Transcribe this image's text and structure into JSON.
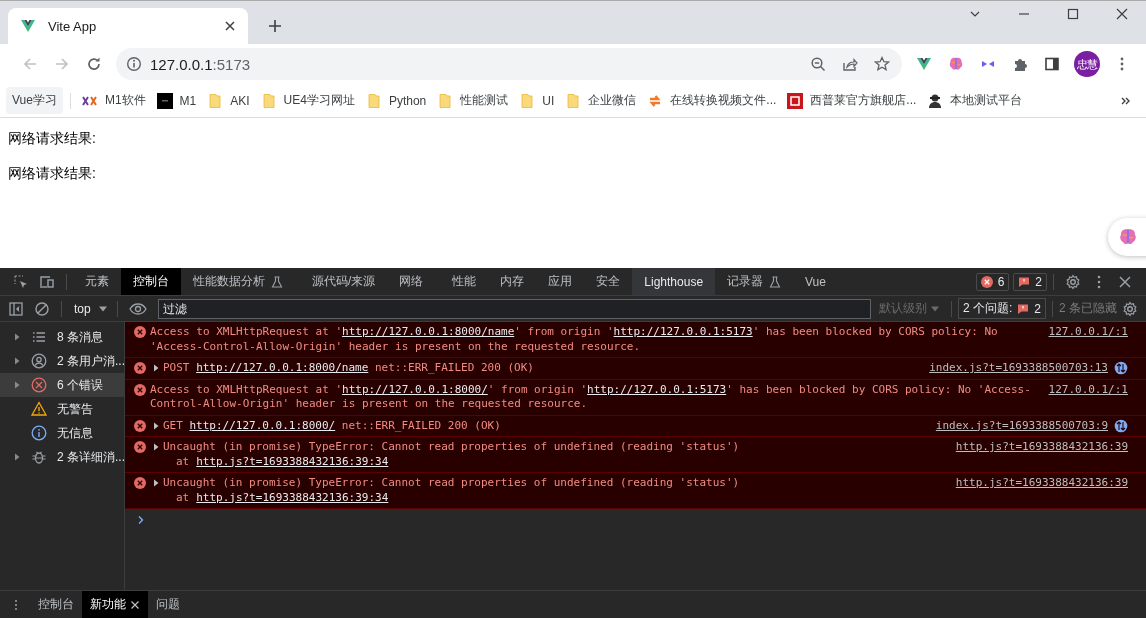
{
  "browser": {
    "tab": {
      "title": "Vite App"
    },
    "address": {
      "host": "127.0.0.1",
      "port": ":5173"
    },
    "avatar": "忠慧",
    "bookmarks": [
      {
        "label": "Vue学习",
        "kind": "chip"
      },
      {
        "label": "M1软件",
        "kind": "xx"
      },
      {
        "label": "M1",
        "kind": "dark"
      },
      {
        "label": "AKI",
        "kind": "folder"
      },
      {
        "label": "UE4学习网址",
        "kind": "folder"
      },
      {
        "label": "Python",
        "kind": "folder"
      },
      {
        "label": "性能测试",
        "kind": "folder"
      },
      {
        "label": "UI",
        "kind": "folder"
      },
      {
        "label": "企业微信",
        "kind": "folder"
      },
      {
        "label": "在线转换视频文件...",
        "kind": "swap"
      },
      {
        "label": "西普莱官方旗舰店...",
        "kind": "shop"
      },
      {
        "label": "本地测试平台",
        "kind": "figure"
      }
    ]
  },
  "page": {
    "lines": [
      "网络请求结果:",
      "网络请求结果:"
    ]
  },
  "devtools": {
    "tabs": [
      {
        "label": "元素",
        "selected": false,
        "hovered": false,
        "experimental": false
      },
      {
        "label": "控制台",
        "selected": true,
        "hovered": false,
        "experimental": false
      },
      {
        "label": "性能数据分析",
        "selected": false,
        "hovered": false,
        "experimental": true
      },
      {
        "label": "源代码/来源",
        "selected": false,
        "hovered": false,
        "experimental": false
      },
      {
        "label": "网络",
        "selected": false,
        "hovered": false,
        "experimental": false
      },
      {
        "label": "性能",
        "selected": false,
        "hovered": false,
        "experimental": false
      },
      {
        "label": "内存",
        "selected": false,
        "hovered": false,
        "experimental": false
      },
      {
        "label": "应用",
        "selected": false,
        "hovered": false,
        "experimental": false
      },
      {
        "label": "安全",
        "selected": false,
        "hovered": false,
        "experimental": false
      },
      {
        "label": "Lighthouse",
        "selected": false,
        "hovered": true,
        "experimental": false
      },
      {
        "label": "记录器",
        "selected": false,
        "hovered": false,
        "experimental": true
      },
      {
        "label": "Vue",
        "selected": false,
        "hovered": false,
        "experimental": false
      }
    ],
    "error_count": "6",
    "issue_count": "2",
    "context": "top",
    "filter": {
      "placeholder": "过滤"
    },
    "level": "默认级别",
    "issues": {
      "label": "2 个问题:",
      "count": "2"
    },
    "hidden": "2 条已隐藏",
    "sidebar": [
      {
        "label": "8 条消息",
        "kind": "list",
        "expandable": true,
        "selected": false
      },
      {
        "label": "2 条用户消...",
        "kind": "user",
        "expandable": true,
        "selected": false
      },
      {
        "label": "6 个错误",
        "kind": "error",
        "expandable": true,
        "selected": true
      },
      {
        "label": "无警告",
        "kind": "warning",
        "expandable": false,
        "selected": false
      },
      {
        "label": "无信息",
        "kind": "info",
        "expandable": false,
        "selected": false
      },
      {
        "label": "2 条详细消...",
        "kind": "verbose",
        "expandable": true,
        "selected": false
      }
    ],
    "messages": [
      {
        "expandable": false,
        "network": false,
        "source": "127.0.0.1/:1",
        "parts": [
          {
            "kind": "text",
            "text": "Access to XMLHttpRequest at '"
          },
          {
            "kind": "link",
            "text": "http://127.0.0.1:8000/name"
          },
          {
            "kind": "text",
            "text": "' from origin '"
          },
          {
            "kind": "link",
            "text": "http://127.0.0.1:5173"
          },
          {
            "kind": "text",
            "text": "' has been blocked by CORS policy: No 'Access-Control-Allow-Origin' header is present on the requested resource."
          }
        ]
      },
      {
        "expandable": true,
        "network": true,
        "source": "index.js?t=1693388500703:13",
        "parts": [
          {
            "kind": "text",
            "text": "POST "
          },
          {
            "kind": "link",
            "text": "http://127.0.0.1:8000/name"
          },
          {
            "kind": "text",
            "text": " net::ERR_FAILED 200 (OK)"
          }
        ]
      },
      {
        "expandable": false,
        "network": false,
        "source": "127.0.0.1/:1",
        "parts": [
          {
            "kind": "text",
            "text": "Access to XMLHttpRequest at '"
          },
          {
            "kind": "link",
            "text": "http://127.0.0.1:8000/"
          },
          {
            "kind": "text",
            "text": "' from origin '"
          },
          {
            "kind": "link",
            "text": "http://127.0.0.1:5173"
          },
          {
            "kind": "text",
            "text": "' has been blocked by CORS policy: No 'Access-Control-Allow-Origin' header is present on the requested resource."
          }
        ]
      },
      {
        "expandable": true,
        "network": true,
        "source": "index.js?t=1693388500703:9",
        "parts": [
          {
            "kind": "text",
            "text": "GET "
          },
          {
            "kind": "link",
            "text": "http://127.0.0.1:8000/"
          },
          {
            "kind": "text",
            "text": " net::ERR_FAILED 200 (OK)"
          }
        ]
      },
      {
        "expandable": true,
        "network": false,
        "source": "http.js?t=1693388432136:39",
        "parts": [
          {
            "kind": "text",
            "text": "Uncaught (in promise) TypeError: Cannot read properties of undefined (reading 'status')"
          }
        ],
        "stack": {
          "prefix": "at",
          "link": "http.js?t=1693388432136:39:34"
        }
      },
      {
        "expandable": true,
        "network": false,
        "source": "http.js?t=1693388432136:39",
        "parts": [
          {
            "kind": "text",
            "text": "Uncaught (in promise) TypeError: Cannot read properties of undefined (reading 'status')"
          }
        ],
        "stack": {
          "prefix": "at",
          "link": "http.js?t=1693388432136:39:34"
        }
      }
    ],
    "drawer_tabs": [
      {
        "label": "控制台",
        "selected": false,
        "closable": false
      },
      {
        "label": "新功能",
        "selected": true,
        "closable": true
      },
      {
        "label": "问题",
        "selected": false,
        "closable": false
      }
    ]
  }
}
